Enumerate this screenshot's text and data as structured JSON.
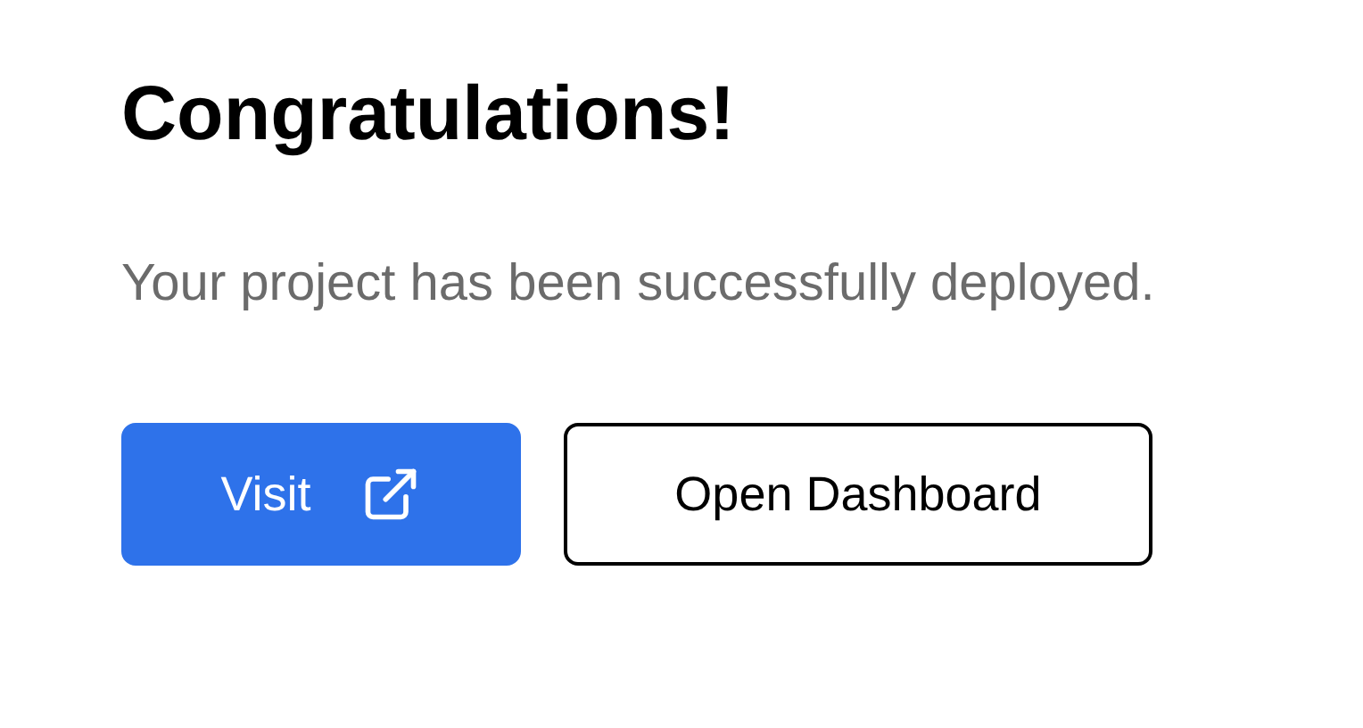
{
  "heading": "Congratulations!",
  "message": "Your project has been successfully deployed.",
  "buttons": [
    {
      "label": "Visit",
      "kind": "primary",
      "external": true
    },
    {
      "label": "Open Dashboard",
      "kind": "outline",
      "external": false
    }
  ]
}
